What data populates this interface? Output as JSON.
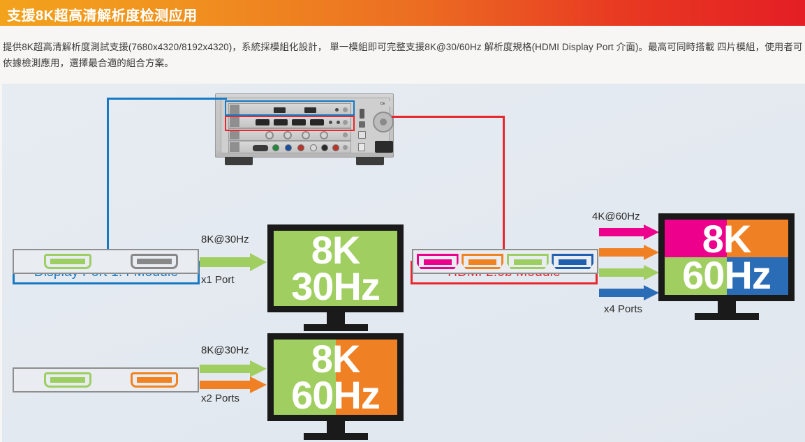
{
  "header": {
    "title": "支援8K超高清解析度检测应用",
    "gradient_from": "#f3a21c",
    "gradient_to": "#e41e24"
  },
  "intro": {
    "line1": "提供8K超高清解析度測試支援(7680x4320/8192x4320)，系統採模組化設計， 單一模組即可完整支援8K@30/60Hz 解析度規格(HDMI Display Port 介面)。最高可同時搭載",
    "line2": "四片模組，使用者可依據檢測應用，選擇最合適的組合方案。"
  },
  "diagram": {
    "background": "#e4eaf1",
    "labels": {
      "dp_module": "Display Port 1.4 Module",
      "hdmi_module": "HDMI 2.0b Module",
      "dp_module_color": "#1679c4",
      "hdmi_module_color": "#e8262d"
    },
    "rows": [
      {
        "id": "dp-1port",
        "ports_label_top": "8K@30Hz",
        "ports_label_bottom": "x1 Port",
        "connector_type": "displayport",
        "connectors": [
          {
            "color_name": "green",
            "color": "#9cce62",
            "active": true
          },
          {
            "color_name": "gray",
            "color": "#888888",
            "active": false
          }
        ],
        "arrows": [
          {
            "color": "#9cce62"
          }
        ],
        "monitor": {
          "text_top": "8K",
          "text_bottom": "30Hz",
          "quadrants": [
            "#a0ce61",
            "#a0ce61",
            "#a0ce61",
            "#a0ce61"
          ],
          "split": "none"
        }
      },
      {
        "id": "dp-2ports",
        "ports_label_top": "8K@30Hz",
        "ports_label_bottom": "x2 Ports",
        "connector_type": "displayport",
        "connectors": [
          {
            "color_name": "green",
            "color": "#9cce62",
            "active": true
          },
          {
            "color_name": "orange",
            "color": "#f0821f",
            "active": true
          }
        ],
        "arrows": [
          {
            "color": "#9cce62"
          },
          {
            "color": "#f0821f"
          }
        ],
        "monitor": {
          "text_top": "8K",
          "text_bottom": "60Hz",
          "quadrants": [
            "#a0ce61",
            "#f08024"
          ],
          "split": "vertical"
        }
      },
      {
        "id": "hdmi-4ports",
        "ports_label_top": "4K@60Hz",
        "ports_label_bottom": "x4 Ports",
        "connector_type": "hdmi",
        "connectors": [
          {
            "color_name": "magenta",
            "color": "#ec008c",
            "active": true
          },
          {
            "color_name": "orange",
            "color": "#f0821f",
            "active": true
          },
          {
            "color_name": "green",
            "color": "#9cce62",
            "active": true
          },
          {
            "color_name": "blue",
            "color": "#1f5fae",
            "active": true
          }
        ],
        "arrows": [
          {
            "color": "#ec008c"
          },
          {
            "color": "#f08024"
          },
          {
            "color": "#a0ce61"
          },
          {
            "color": "#2b6cb7"
          }
        ],
        "monitor": {
          "text_top": "8K",
          "text_bottom": "60Hz",
          "quadrants": [
            "#ec008c",
            "#f08024",
            "#a0ce61",
            "#2b6cb7"
          ],
          "split": "quad"
        }
      }
    ],
    "device": {
      "name": "rear-panel-chassis",
      "cert_marks": "CE",
      "module_rows": 4
    }
  }
}
